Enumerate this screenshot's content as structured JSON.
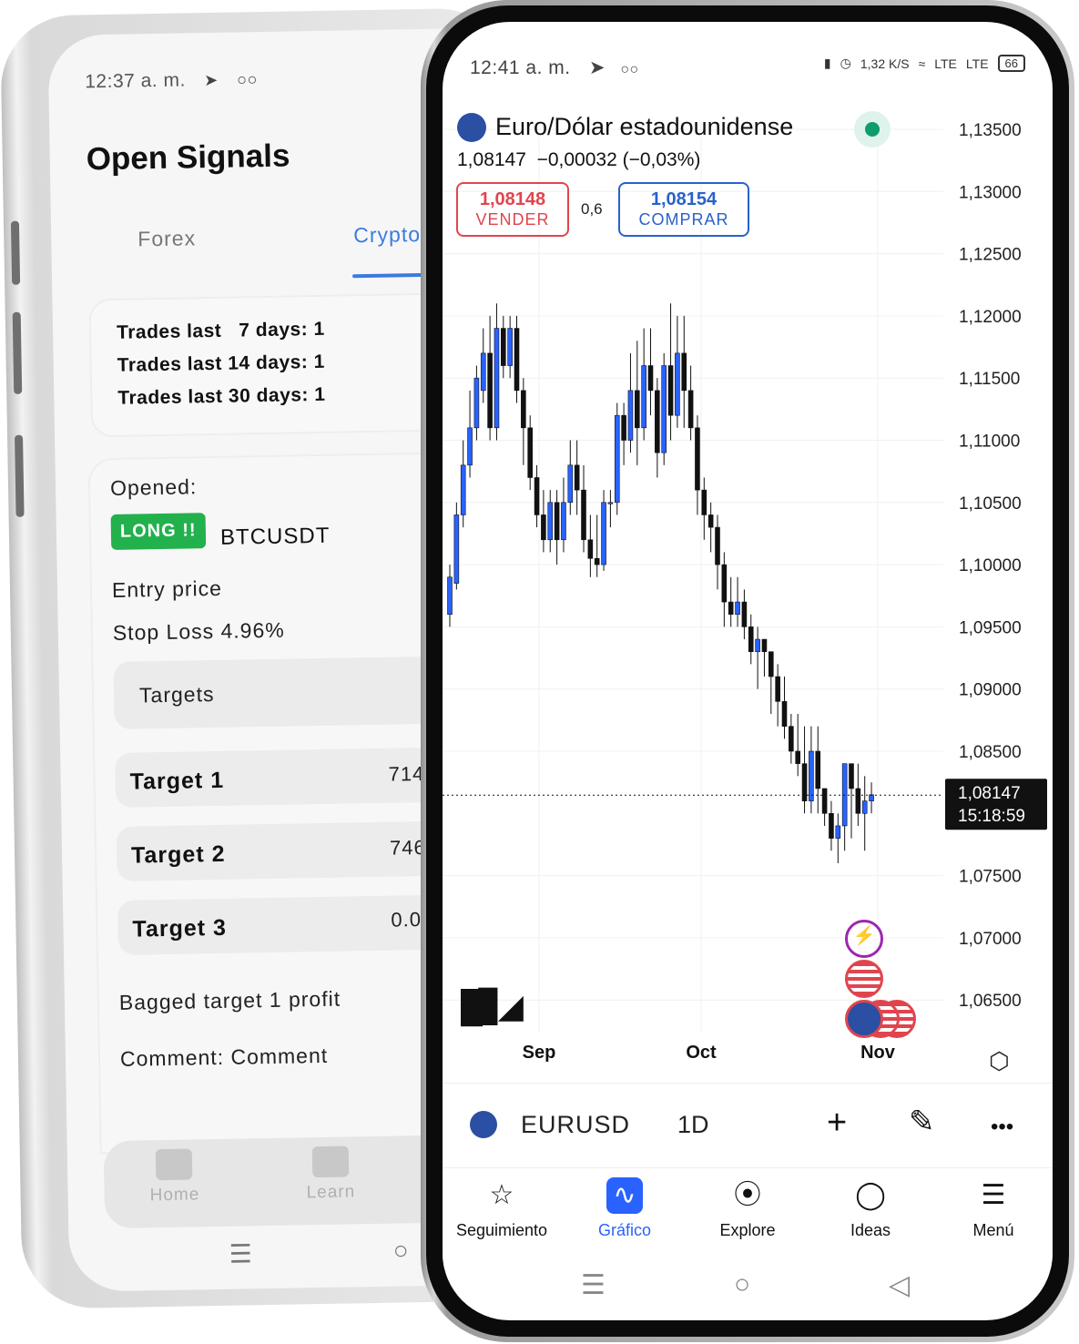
{
  "back_phone": {
    "status_time": "12:37 a. m.",
    "title": "Open Signals",
    "tabs": [
      "Forex",
      "Crypto"
    ],
    "stats": [
      {
        "label": "Trades last",
        "days": "7 days: 1"
      },
      {
        "label": "Trades last",
        "days": "14 days: 1"
      },
      {
        "label": "Trades last",
        "days": "30 days: 1"
      }
    ],
    "opened_label": "Opened:",
    "badge": "LONG !!",
    "pair": "BTCUSDT",
    "entry_label": "Entry price",
    "stop_loss": "Stop Loss 4.96%",
    "targets_header": "Targets",
    "targets": [
      {
        "name": "Target 1",
        "value": "714"
      },
      {
        "name": "Target 2",
        "value": "746"
      },
      {
        "name": "Target 3",
        "value": "0.0"
      }
    ],
    "bagged": "Bagged target 1 profit",
    "comment": "Comment: Comment",
    "nav": [
      "Home",
      "Learn"
    ]
  },
  "front_phone": {
    "status_time": "12:41 a. m.",
    "status_right": {
      "speed": "1,32 K/S",
      "lte1": "LTE",
      "lte2": "LTE",
      "battery": "66"
    },
    "symbol_title": "Euro/Dólar estadounidense",
    "price": "1,08147",
    "change": "−0,00032 (−0,03%)",
    "sell": {
      "price": "1,08148",
      "label": "VENDER"
    },
    "spread": "0,6",
    "buy": {
      "price": "1,08154",
      "label": "COMPRAR"
    },
    "last_price_label": "1,08147",
    "countdown": "15:18:59",
    "toolbar": {
      "symbol": "EURUSD",
      "interval": "1D",
      "add": "+",
      "more": "•••"
    },
    "nav": [
      {
        "label": "Seguimiento",
        "icon": "star-icon"
      },
      {
        "label": "Gráfico",
        "icon": "chart-icon"
      },
      {
        "label": "Explore",
        "icon": "compass-icon"
      },
      {
        "label": "Ideas",
        "icon": "bulb-icon"
      },
      {
        "label": "Menú",
        "icon": "menu-icon"
      }
    ],
    "colors": {
      "up": "#2962ff",
      "down": "#111111",
      "sell": "#e0454e",
      "buy": "#2962c9"
    }
  },
  "chart_data": {
    "type": "candlestick",
    "title": "Euro/Dólar estadounidense",
    "yticks": [
      "1,13500",
      "1,13000",
      "1,12500",
      "1,12000",
      "1,11500",
      "1,11000",
      "1,10500",
      "1,10000",
      "1,09500",
      "1,09000",
      "1,08500",
      "1,07500",
      "1,07000",
      "1,06500"
    ],
    "ylim": [
      1.0625,
      1.1375
    ],
    "xticks": [
      "Sep",
      "Oct",
      "Nov"
    ],
    "last_price": 1.08147,
    "grid": true,
    "candles": [
      [
        1.096,
        1.099,
        1.095,
        1.1
      ],
      [
        1.0985,
        1.104,
        1.098,
        1.105
      ],
      [
        1.104,
        1.108,
        1.103,
        1.11
      ],
      [
        1.108,
        1.111,
        1.107,
        1.114
      ],
      [
        1.111,
        1.115,
        1.11,
        1.116
      ],
      [
        1.114,
        1.117,
        1.113,
        1.119
      ],
      [
        1.117,
        1.111,
        1.11,
        1.12
      ],
      [
        1.111,
        1.119,
        1.11,
        1.121
      ],
      [
        1.119,
        1.116,
        1.115,
        1.12
      ],
      [
        1.116,
        1.119,
        1.115,
        1.12
      ],
      [
        1.119,
        1.114,
        1.113,
        1.12
      ],
      [
        1.114,
        1.111,
        1.108,
        1.115
      ],
      [
        1.111,
        1.107,
        1.106,
        1.112
      ],
      [
        1.107,
        1.104,
        1.103,
        1.108
      ],
      [
        1.104,
        1.102,
        1.101,
        1.106
      ],
      [
        1.102,
        1.105,
        1.101,
        1.106
      ],
      [
        1.105,
        1.102,
        1.1,
        1.106
      ],
      [
        1.102,
        1.105,
        1.101,
        1.107
      ],
      [
        1.105,
        1.108,
        1.104,
        1.11
      ],
      [
        1.108,
        1.106,
        1.104,
        1.11
      ],
      [
        1.106,
        1.102,
        1.101,
        1.108
      ],
      [
        1.102,
        1.1005,
        1.099,
        1.104
      ],
      [
        1.1005,
        1.1,
        1.099,
        1.104
      ],
      [
        1.1,
        1.105,
        1.0995,
        1.106
      ],
      [
        1.105,
        1.105,
        1.103,
        1.106
      ],
      [
        1.105,
        1.112,
        1.104,
        1.113
      ],
      [
        1.112,
        1.11,
        1.108,
        1.113
      ],
      [
        1.11,
        1.114,
        1.109,
        1.117
      ],
      [
        1.114,
        1.111,
        1.108,
        1.118
      ],
      [
        1.111,
        1.116,
        1.11,
        1.119
      ],
      [
        1.116,
        1.114,
        1.112,
        1.119
      ],
      [
        1.114,
        1.109,
        1.107,
        1.115
      ],
      [
        1.109,
        1.116,
        1.108,
        1.117
      ],
      [
        1.116,
        1.112,
        1.11,
        1.121
      ],
      [
        1.112,
        1.117,
        1.111,
        1.12
      ],
      [
        1.117,
        1.114,
        1.111,
        1.12
      ],
      [
        1.114,
        1.111,
        1.11,
        1.116
      ],
      [
        1.111,
        1.106,
        1.104,
        1.112
      ],
      [
        1.106,
        1.104,
        1.102,
        1.107
      ],
      [
        1.104,
        1.103,
        1.101,
        1.105
      ],
      [
        1.103,
        1.1,
        1.098,
        1.104
      ],
      [
        1.1,
        1.097,
        1.095,
        1.101
      ],
      [
        1.097,
        1.096,
        1.095,
        1.099
      ],
      [
        1.096,
        1.097,
        1.095,
        1.099
      ],
      [
        1.097,
        1.095,
        1.094,
        1.098
      ],
      [
        1.095,
        1.093,
        1.092,
        1.096
      ],
      [
        1.093,
        1.094,
        1.09,
        1.095
      ],
      [
        1.094,
        1.093,
        1.091,
        1.094
      ],
      [
        1.093,
        1.091,
        1.088,
        1.093
      ],
      [
        1.091,
        1.089,
        1.087,
        1.092
      ],
      [
        1.089,
        1.087,
        1.086,
        1.091
      ],
      [
        1.087,
        1.085,
        1.084,
        1.088
      ],
      [
        1.085,
        1.084,
        1.083,
        1.088
      ],
      [
        1.084,
        1.081,
        1.08,
        1.087
      ],
      [
        1.081,
        1.085,
        1.08,
        1.087
      ],
      [
        1.085,
        1.082,
        1.08,
        1.087
      ],
      [
        1.082,
        1.08,
        1.079,
        1.082
      ],
      [
        1.08,
        1.078,
        1.077,
        1.081
      ],
      [
        1.078,
        1.079,
        1.076,
        1.08
      ],
      [
        1.079,
        1.084,
        1.077,
        1.084
      ],
      [
        1.084,
        1.082,
        1.078,
        1.084
      ],
      [
        1.082,
        1.08,
        1.079,
        1.084
      ],
      [
        1.08,
        1.081,
        1.077,
        1.083
      ],
      [
        1.081,
        1.0815,
        1.08,
        1.0825
      ]
    ]
  }
}
